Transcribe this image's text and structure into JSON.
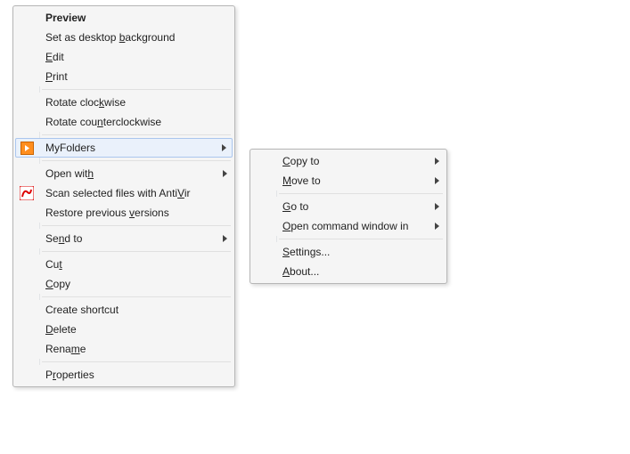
{
  "main": {
    "preview": "Preview",
    "set_bg_before": "Set as desktop ",
    "set_bg_u": "b",
    "set_bg_after": "ackground",
    "edit_u": "E",
    "edit_after": "dit",
    "print_u": "P",
    "print_after": "rint",
    "rot_cw_before": "Rotate cloc",
    "rot_cw_u": "k",
    "rot_cw_after": "wise",
    "rot_ccw_before": "Rotate cou",
    "rot_ccw_u": "n",
    "rot_ccw_after": "terclockwise",
    "myfolders": "MyFolders",
    "openwith_before": "Open wit",
    "openwith_u": "h",
    "scan_before": "Scan selected files with Anti",
    "scan_u": "V",
    "scan_after": "ir",
    "restore_before": "Restore previous ",
    "restore_u": "v",
    "restore_after": "ersions",
    "sendto_before": "Se",
    "sendto_u": "n",
    "sendto_after": "d to",
    "cut_before": "Cu",
    "cut_u": "t",
    "copy_u": "C",
    "copy_after": "opy",
    "shortcut": "Create shortcut",
    "delete_u": "D",
    "delete_after": "elete",
    "rename_before": "Rena",
    "rename_u": "m",
    "rename_after": "e",
    "properties_before": "P",
    "properties_u": "r",
    "properties_after": "operties"
  },
  "sub": {
    "copyto_u": "C",
    "copyto_after": "opy to",
    "moveto_u": "M",
    "moveto_after": "ove to",
    "goto_u": "G",
    "goto_after": "o to",
    "cmd_u": "O",
    "cmd_after": "pen command window in",
    "settings_u": "S",
    "settings_after": "ettings...",
    "about_u": "A",
    "about_after": "bout..."
  }
}
